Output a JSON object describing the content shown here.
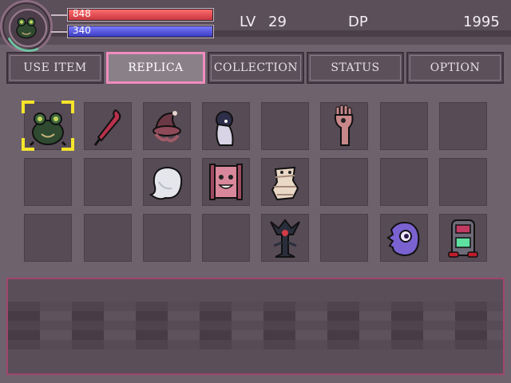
{
  "player": {
    "portrait_icon": "frog-icon",
    "hp": {
      "value": "848",
      "fill_fraction": 1.0,
      "color": "#e0454d"
    },
    "mp": {
      "value": "340",
      "fill_fraction": 1.0,
      "color": "#5656e0"
    }
  },
  "stats": {
    "lv_label": "LV",
    "lv_value": "29",
    "dp_label": "DP",
    "dp_value": "1995"
  },
  "tabs": [
    {
      "label": "USE ITEM",
      "active": false
    },
    {
      "label": "REPLICA",
      "active": true
    },
    {
      "label": "COLLECTION",
      "active": false
    },
    {
      "label": "STATUS",
      "active": false
    },
    {
      "label": "OPTION",
      "active": false
    }
  ],
  "colors": {
    "active_tab_border": "#f08cbd",
    "cursor": "#f5e42a",
    "description_border": "#a0466d"
  },
  "replica_grid": {
    "selected_slot": 0,
    "slots": [
      "frog-icon",
      "umbrella-icon",
      "witch-hat-icon",
      "bowing-ghost-icon",
      "empty",
      "hand-with-eye-icon",
      "empty",
      "empty",
      "empty",
      "empty",
      "white-ghost-icon",
      "scroll-face-icon",
      "bandaged-ghost-icon",
      "empty",
      "empty",
      "empty",
      "empty",
      "empty",
      "empty",
      "empty",
      "dark-tree-icon",
      "empty",
      "purple-one-eyed-blob-icon",
      "vending-machine-icon"
    ]
  },
  "description": {
    "text": ""
  }
}
